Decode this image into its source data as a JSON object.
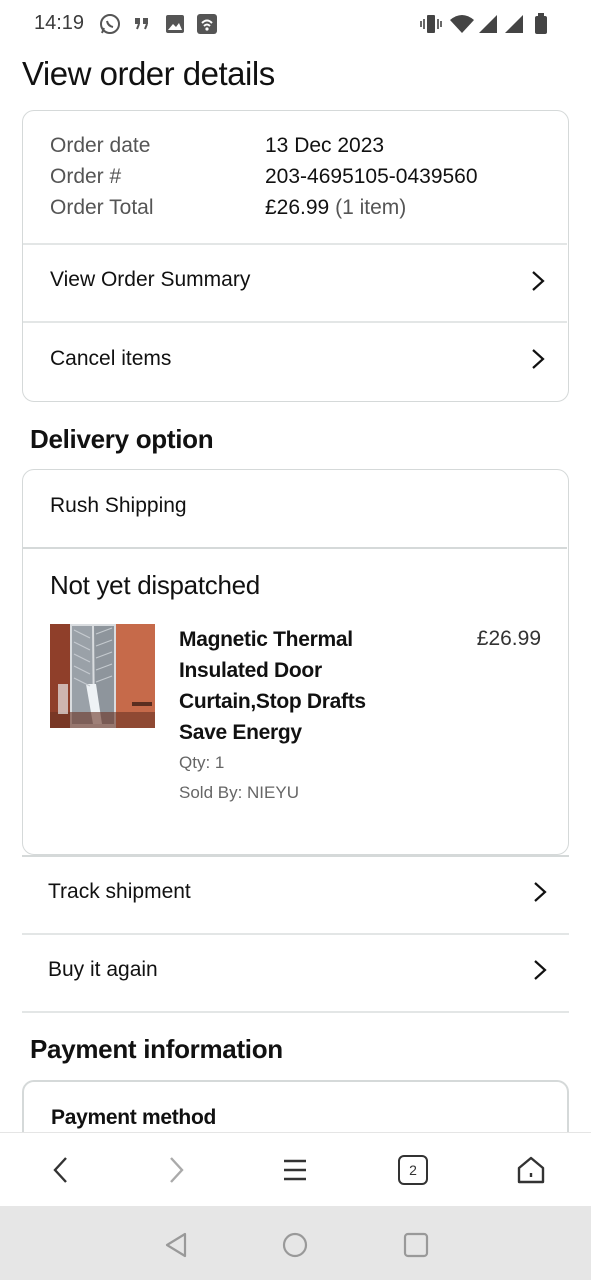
{
  "status_bar": {
    "time": "14:19",
    "left_icons": [
      "whatsapp-icon",
      "quote-icon",
      "image-icon",
      "cast-icon"
    ],
    "right_icons": [
      "vibrate-icon",
      "wifi-icon",
      "signal-icon",
      "signal-icon",
      "battery-icon"
    ]
  },
  "page": {
    "title": "View order details"
  },
  "order_card": {
    "date_label": "Order date",
    "date_value": "13 Dec 2023",
    "number_label": "Order #",
    "number_value": "203-4695105-0439560",
    "total_label": "Order Total",
    "total_value": "£26.99",
    "total_items": "(1 item)",
    "view_summary_label": "View Order Summary",
    "cancel_label": "Cancel items"
  },
  "delivery": {
    "section_title": "Delivery option",
    "option": "Rush Shipping",
    "status": "Not yet dispatched",
    "product": {
      "name": "Magnetic Thermal Insulated Door Curtain,Stop Drafts Save Energy",
      "price": "£26.99",
      "qty": "Qty: 1",
      "seller": "Sold By: NIEYU"
    }
  },
  "actions": {
    "track_label": "Track shipment",
    "buy_again_label": "Buy it again"
  },
  "payment": {
    "section_title": "Payment information",
    "method_label": "Payment method"
  },
  "browser_nav": {
    "tab_count": "2",
    "icons": [
      "back-icon",
      "forward-icon",
      "menu-icon",
      "tabs-icon",
      "home-icon"
    ]
  },
  "android_nav": {
    "icons": [
      "android-back-icon",
      "android-home-icon",
      "android-recents-icon"
    ]
  }
}
